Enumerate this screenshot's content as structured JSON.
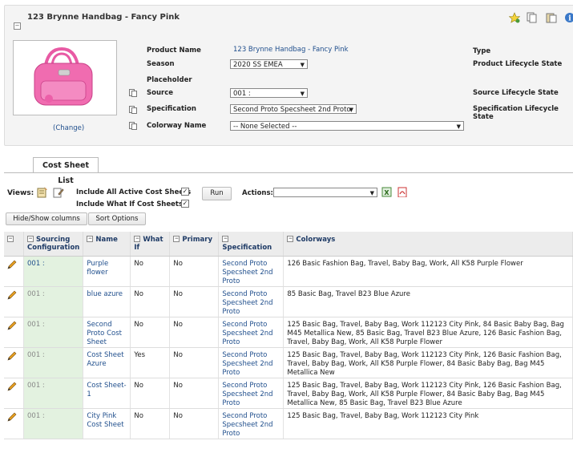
{
  "header": {
    "title": "123 Brynne Handbag - Fancy Pink",
    "change_link": "(Change)"
  },
  "fields": {
    "product_name_label": "Product Name",
    "product_name_value": "123 Brynne Handbag - Fancy Pink",
    "season_label": "Season",
    "season_value": "2020 SS EMEA",
    "placeholder_label": "Placeholder",
    "source_label": "Source",
    "source_value": "001 :",
    "specification_label": "Specification",
    "specification_value": "Second Proto Specsheet 2nd Proto",
    "colorway_label": "Colorway Name",
    "colorway_value": "-- None Selected --",
    "type_label": "Type",
    "plc_label": "Product Lifecycle State",
    "slc_label": "Source Lifecycle State",
    "speclc_label": "Specification Lifecycle State"
  },
  "tabs": {
    "cost_sheet_list": "Cost Sheet List"
  },
  "toolbar": {
    "views_label": "Views:",
    "include_active_label": "Include All Active Cost Sheets",
    "include_whatif_label": "Include What If Cost Sheets",
    "run_label": "Run",
    "actions_label": "Actions:",
    "hide_show_label": "Hide/Show columns",
    "sort_label": "Sort Options"
  },
  "table": {
    "headers": {
      "sourcing": "Sourcing Configuration",
      "name": "Name",
      "whatif": "What If",
      "primary": "Primary",
      "specification": "Specification",
      "colorways": "Colorways"
    },
    "rows": [
      {
        "source": "001 :",
        "name": "Purple flower",
        "whatif": "No",
        "primary": "No",
        "spec": "Second Proto Specsheet 2nd Proto",
        "colorways": "126 Basic Fashion Bag, Travel, Baby Bag, Work, All K58 Purple Flower"
      },
      {
        "source": "001 :",
        "name": "blue azure",
        "whatif": "No",
        "primary": "No",
        "spec": "Second Proto Specsheet 2nd Proto",
        "colorways": "85 Basic Bag, Travel B23 Blue Azure"
      },
      {
        "source": "001 :",
        "name": "Second Proto Cost Sheet",
        "whatif": "No",
        "primary": "No",
        "spec": "Second Proto Specsheet 2nd Proto",
        "colorways": "125 Basic Bag, Travel, Baby Bag, Work 112123 City Pink, 84 Basic Baby Bag, Bag M45 Metallica New, 85 Basic Bag, Travel B23 Blue Azure, 126 Basic Fashion Bag, Travel, Baby Bag, Work, All K58 Purple Flower"
      },
      {
        "source": "001 :",
        "name": "Cost Sheet Azure",
        "whatif": "Yes",
        "primary": "No",
        "spec": "Second Proto Specsheet 2nd Proto",
        "colorways": "125 Basic Bag, Travel, Baby Bag, Work 112123 City Pink, 126 Basic Fashion Bag, Travel, Baby Bag, Work, All K58 Purple Flower, 84 Basic Baby Bag, Bag M45 Metallica New"
      },
      {
        "source": "001 :",
        "name": "Cost Sheet-1",
        "whatif": "No",
        "primary": "No",
        "spec": "Second Proto Specsheet 2nd Proto",
        "colorways": "125 Basic Bag, Travel, Baby Bag, Work 112123 City Pink, 126 Basic Fashion Bag, Travel, Baby Bag, Work, All K58 Purple Flower, 84 Basic Baby Bag, Bag M45 Metallica New, 85 Basic Bag, Travel B23 Blue Azure"
      },
      {
        "source": "001 :",
        "name": "City Pink Cost Sheet",
        "whatif": "No",
        "primary": "No",
        "spec": "Second Proto Specsheet 2nd Proto",
        "colorways": "125 Basic Bag, Travel, Baby Bag, Work 112123 City Pink"
      }
    ]
  },
  "colors": {
    "link": "#1f4e8c",
    "source_cell_bg": "#e3f2e0",
    "bag_pink": "#f06cb0"
  }
}
